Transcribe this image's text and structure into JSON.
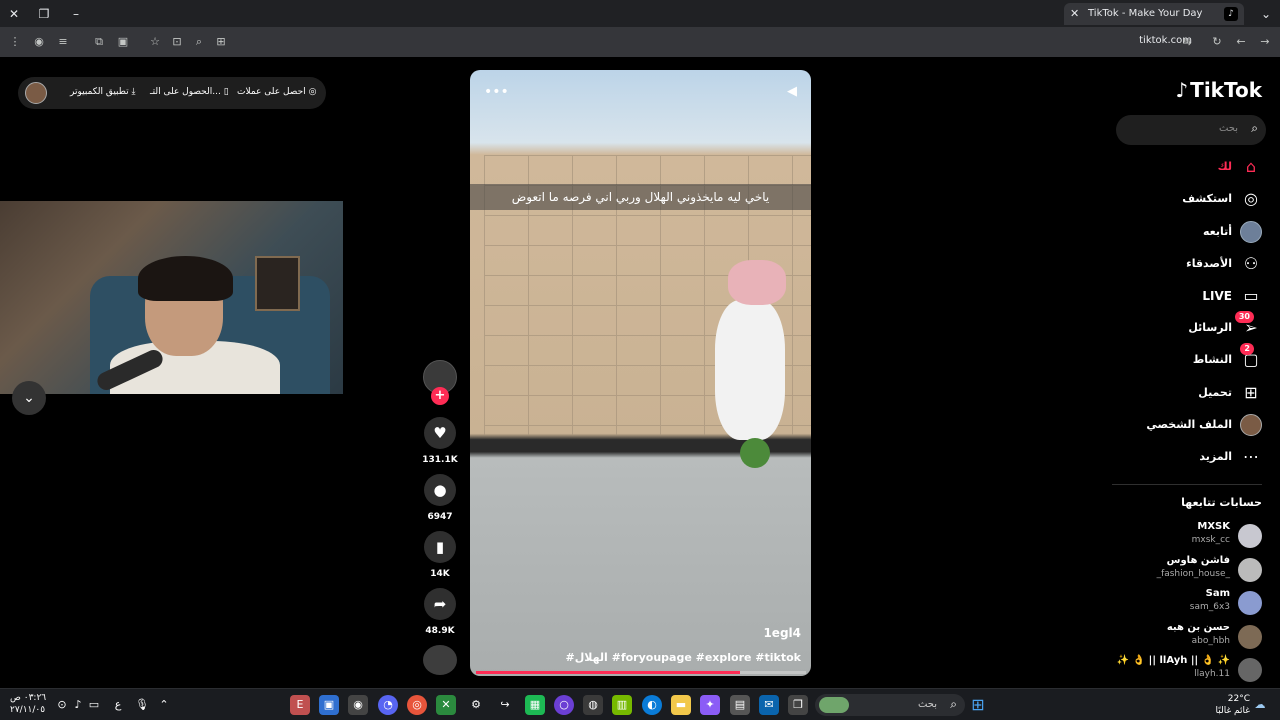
{
  "browser": {
    "tab_title": "TikTok - Make Your Day",
    "url": "tiktok.com"
  },
  "pill": {
    "get_coins": "احصل على عملات",
    "get_app": "الحصول على التـ...",
    "desktop_app": "تطبيق الكمبيوتر"
  },
  "video": {
    "caption": "ياخي ليه مايخذوني الهلال وربي اني فرصه ما اتعوض",
    "username": "1egl4",
    "hashtags": "#الهلال #foryoupage #explore #tiktok",
    "progress": 0.8
  },
  "actions": {
    "likes": "131.1K",
    "comments": "6947",
    "saves": "14K",
    "shares": "48.9K"
  },
  "sidebar": {
    "logo": "TikTok",
    "search_placeholder": "بحث",
    "nav": [
      {
        "label": "لك",
        "icon": "home-icon"
      },
      {
        "label": "استكشف",
        "icon": "compass-icon"
      },
      {
        "label": "أتابعه",
        "icon": "avatar"
      },
      {
        "label": "الأصدقاء",
        "icon": "friends-icon"
      },
      {
        "label": "LIVE",
        "icon": "live-icon"
      },
      {
        "label": "الرسائل",
        "icon": "messages-icon",
        "badge": "30"
      },
      {
        "label": "النشاط",
        "icon": "activity-icon",
        "badge": "2"
      },
      {
        "label": "تحميل",
        "icon": "upload-icon"
      },
      {
        "label": "الملف الشخصي",
        "icon": "profile-avatar"
      },
      {
        "label": "المزيد",
        "icon": "more-icon"
      }
    ],
    "following_title": "حسابات تتابعها",
    "accounts": [
      {
        "name": "MXSK",
        "handle": "mxsk_cc"
      },
      {
        "name": "فاشن هاوس",
        "handle": "_fashion_house_"
      },
      {
        "name": "Sam",
        "handle": "sam_6x3"
      },
      {
        "name": "حسن بن هبه",
        "handle": "abo_hbh"
      },
      {
        "name": "✨ 👌 || llAyh || 👌 ✨",
        "handle": "llayh.11"
      }
    ]
  },
  "taskbar": {
    "time": "٠٣:٢٦ ص",
    "date": "٢٧/١١/٠٥",
    "lang": "ع",
    "search_placeholder": "بحث",
    "temperature": "22°C",
    "weather": "غائم غالبًا"
  },
  "colors": {
    "accent": "#fe2c55",
    "background": "#000000"
  }
}
